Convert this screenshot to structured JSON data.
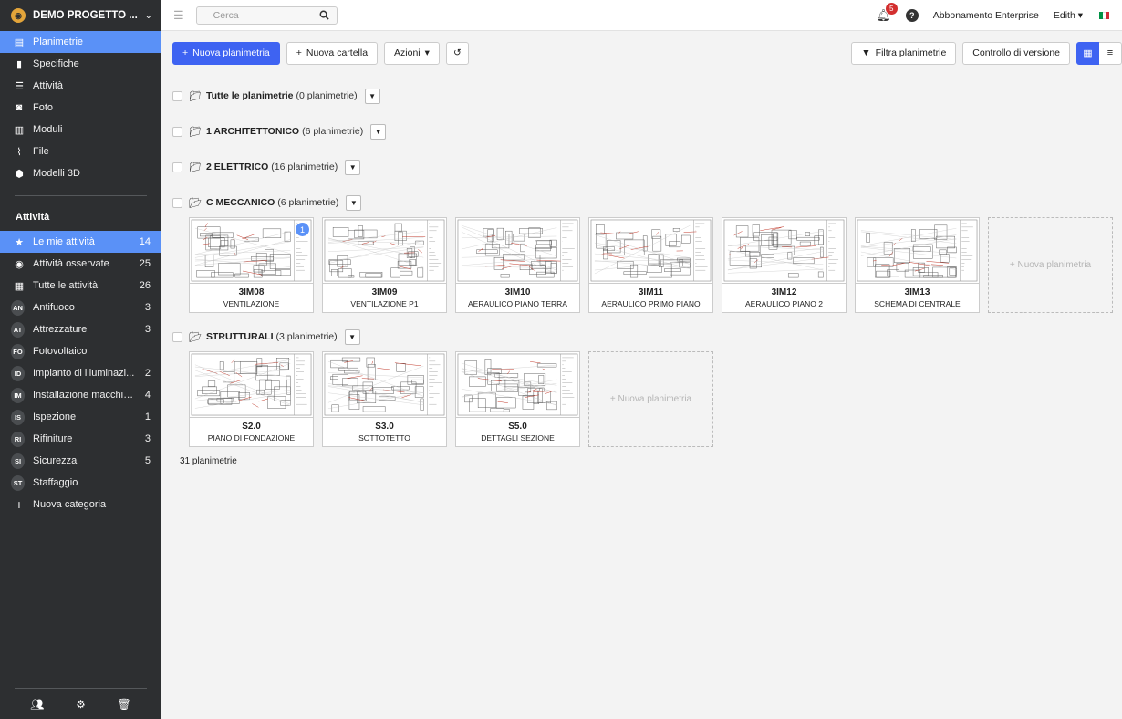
{
  "project": {
    "name": "DEMO PROGETTO ..."
  },
  "nav": [
    {
      "label": "Planimetrie",
      "icon": "map-icon"
    },
    {
      "label": "Specifiche",
      "icon": "book-icon"
    },
    {
      "label": "Attività",
      "icon": "list-icon"
    },
    {
      "label": "Foto",
      "icon": "camera-icon"
    },
    {
      "label": "Moduli",
      "icon": "clipboard-icon"
    },
    {
      "label": "File",
      "icon": "paperclip-icon"
    },
    {
      "label": "Modelli 3D",
      "icon": "cube-icon"
    }
  ],
  "tasks": {
    "title": "Attività",
    "items": [
      {
        "label": "Le mie attività",
        "count": "14",
        "icon": "star-icon"
      },
      {
        "label": "Attività osservate",
        "count": "25",
        "icon": "eye-icon"
      },
      {
        "label": "Tutte le attività",
        "count": "26",
        "icon": "grid-icon"
      }
    ],
    "categories": [
      {
        "abbr": "AN",
        "label": "Antifuoco",
        "count": "3"
      },
      {
        "abbr": "AT",
        "label": "Attrezzature",
        "count": "3"
      },
      {
        "abbr": "FO",
        "label": "Fotovoltaico",
        "count": ""
      },
      {
        "abbr": "ID",
        "label": "Impianto di illuminazi...",
        "count": "2"
      },
      {
        "abbr": "IM",
        "label": "Installazione macchin...",
        "count": "4"
      },
      {
        "abbr": "IS",
        "label": "Ispezione",
        "count": "1"
      },
      {
        "abbr": "RI",
        "label": "Rifiniture",
        "count": "3"
      },
      {
        "abbr": "SI",
        "label": "Sicurezza",
        "count": "5"
      },
      {
        "abbr": "ST",
        "label": "Staffaggio",
        "count": ""
      }
    ],
    "new_category": "Nuova categoria"
  },
  "topbar": {
    "search_placeholder": "Cerca",
    "notifications": "5",
    "subscription": "Abbonamento Enterprise",
    "user": "Edith"
  },
  "toolbar": {
    "new_plan": "Nuova planimetria",
    "new_folder": "Nuova cartella",
    "actions": "Azioni",
    "filter": "Filtra planimetrie",
    "version": "Controllo di versione"
  },
  "folders": [
    {
      "name": "Tutte le planimetrie",
      "count": "(0 planimetrie)",
      "open": false,
      "cards": []
    },
    {
      "name": "1 ARCHITETTONICO",
      "count": "(6 planimetrie)",
      "open": false,
      "cards": []
    },
    {
      "name": "2 ELETTRICO",
      "count": "(16 planimetrie)",
      "open": false,
      "cards": []
    },
    {
      "name": "C MECCANICO",
      "count": "(6 planimetrie)",
      "open": true,
      "cards": [
        {
          "code": "3IM08",
          "name": "VENTILAZIONE",
          "badge": "1"
        },
        {
          "code": "3IM09",
          "name": "VENTILAZIONE P1",
          "badge": ""
        },
        {
          "code": "3IM10",
          "name": "AERAULICO PIANO TERRA",
          "badge": ""
        },
        {
          "code": "3IM11",
          "name": "AERAULICO PRIMO PIANO",
          "badge": ""
        },
        {
          "code": "3IM12",
          "name": "AERAULICO PIANO 2",
          "badge": ""
        },
        {
          "code": "3IM13",
          "name": "SCHEMA DI CENTRALE",
          "badge": ""
        }
      ]
    },
    {
      "name": "STRUTTURALI",
      "count": "(3 planimetrie)",
      "open": true,
      "cards": [
        {
          "code": "S2.0",
          "name": "PIANO DI FONDAZIONE",
          "badge": ""
        },
        {
          "code": "S3.0",
          "name": "SOTTOTETTO",
          "badge": ""
        },
        {
          "code": "S5.0",
          "name": "DETTAGLI SEZIONE",
          "badge": ""
        }
      ]
    }
  ],
  "new_plan_card": "+ Nuova planimetria",
  "total": "31 planimetrie"
}
